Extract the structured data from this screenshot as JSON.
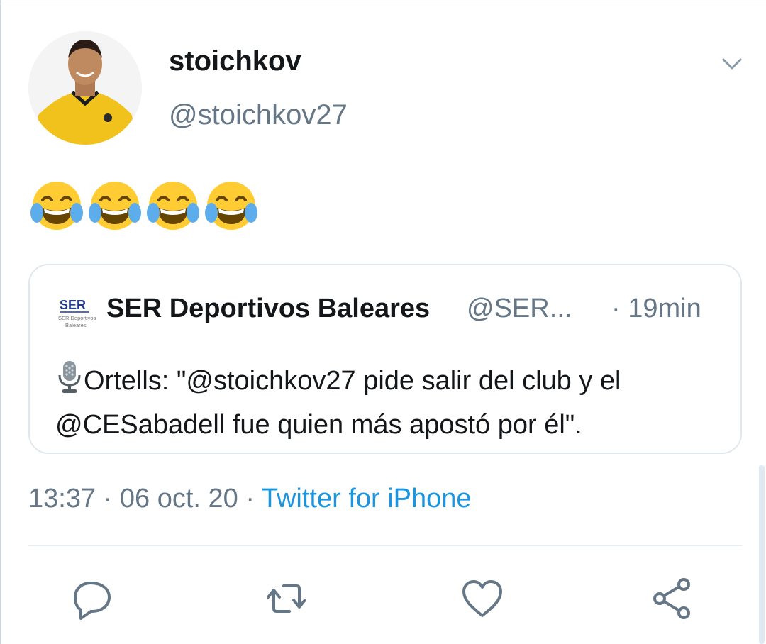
{
  "tweet": {
    "display_name": "stoichkov",
    "handle": "@stoichkov27",
    "emoji_icons": [
      "face-with-tears-of-joy-icon",
      "face-with-tears-of-joy-icon",
      "face-with-tears-of-joy-icon",
      "face-with-tears-of-joy-icon"
    ],
    "quoted": {
      "name": "SER Deportivos Baleares",
      "handle": "@SER...",
      "time": "· 19min",
      "logo_top": "SER",
      "logo_sub1": "SER Deportivos",
      "logo_sub2": "Baleares",
      "text": "Ortells: \"@stoichkov27 pide salir del club y el @CESabadell fue quien más apostó por él\".",
      "text_icon": "microphone-icon"
    },
    "time": "13:37",
    "separator1": " · ",
    "date": "06 oct. 20",
    "separator2": " · ",
    "source": "Twitter for iPhone"
  },
  "actions": [
    {
      "name": "reply",
      "icon": "reply-icon"
    },
    {
      "name": "retweet",
      "icon": "retweet-icon"
    },
    {
      "name": "like",
      "icon": "heart-icon"
    },
    {
      "name": "share",
      "icon": "share-icon"
    }
  ],
  "colors": {
    "text": "#14171a",
    "secondary": "#657786",
    "link": "#1b95e0",
    "border": "#e1e8ed",
    "jersey": "#f2c200"
  }
}
